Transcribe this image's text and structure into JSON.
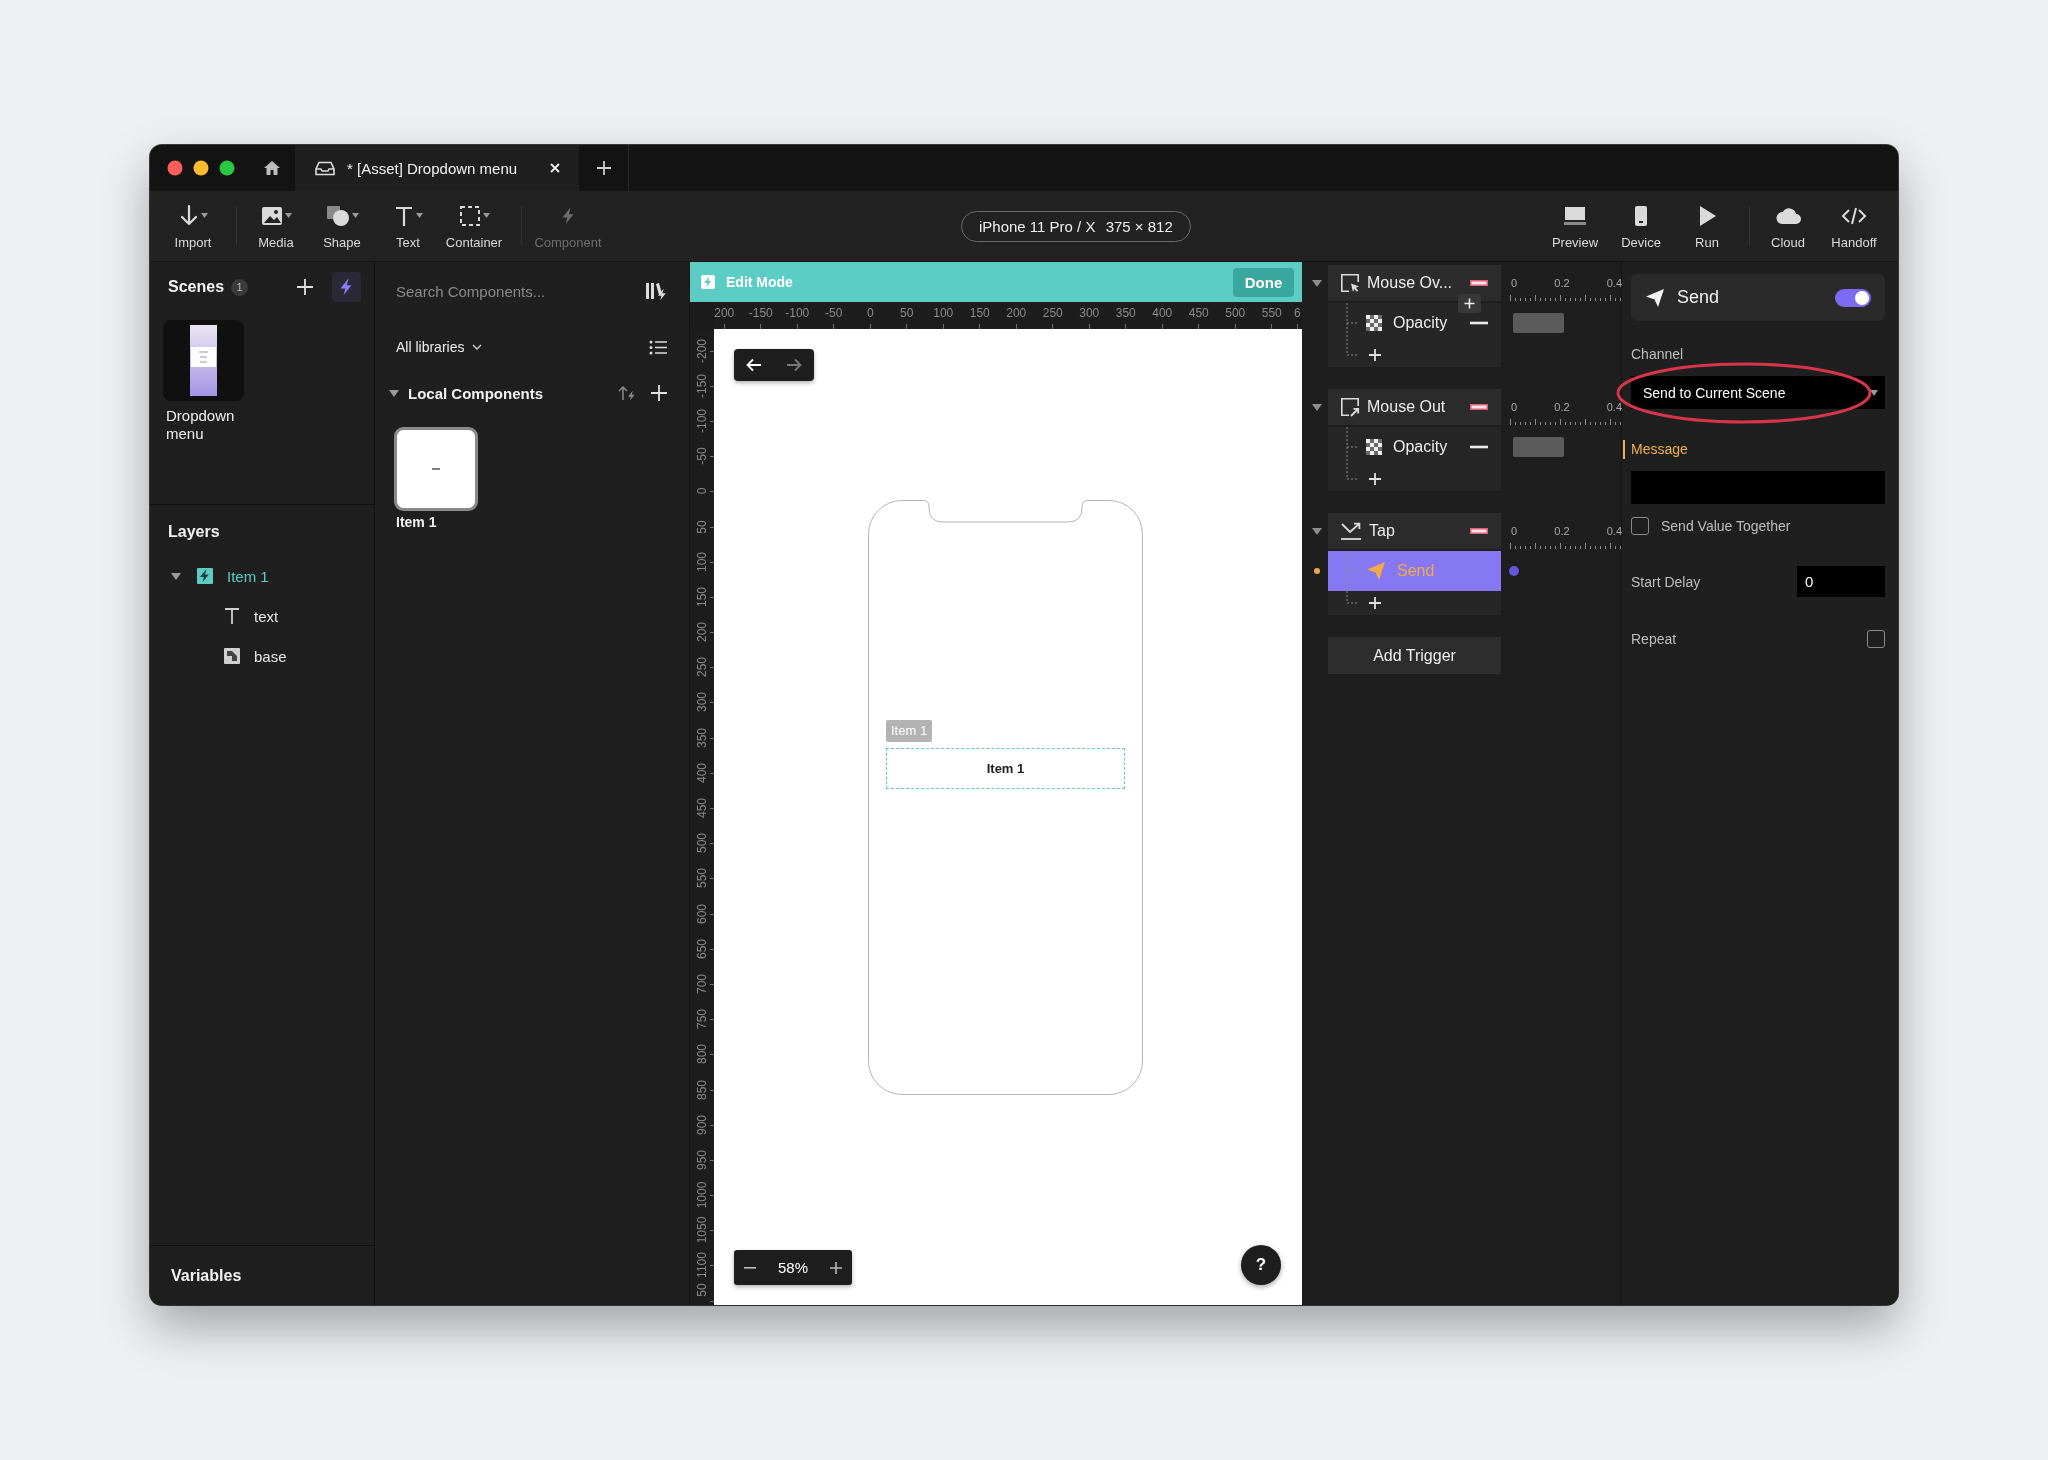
{
  "title_bar": {
    "tabs": [
      {
        "label": "* [Asset] Dropdown menu",
        "selected": true
      }
    ]
  },
  "toolbar": {
    "tool_groups": [
      [
        {
          "label": "Import",
          "kind": "import",
          "menu": true,
          "disabled": false
        }
      ],
      [
        {
          "label": "Media",
          "kind": "media",
          "menu": true,
          "disabled": false
        },
        {
          "label": "Shape",
          "kind": "shape",
          "menu": true,
          "disabled": false
        },
        {
          "label": "Text",
          "kind": "text",
          "menu": true,
          "disabled": false
        },
        {
          "label": "Container",
          "kind": "container",
          "menu": true,
          "disabled": false
        }
      ],
      [
        {
          "label": "Component",
          "kind": "component",
          "menu": false,
          "disabled": true
        }
      ]
    ],
    "device": {
      "name": "iPhone 11 Pro / X",
      "size": "375 × 812"
    },
    "action_groups": [
      [
        {
          "label": "Preview",
          "kind": "preview"
        },
        {
          "label": "Device",
          "kind": "device"
        },
        {
          "label": "Run",
          "kind": "run"
        }
      ],
      [
        {
          "label": "Cloud",
          "kind": "cloud"
        },
        {
          "label": "Handoff",
          "kind": "handoff"
        }
      ]
    ]
  },
  "scenes": {
    "title": "Scenes",
    "count": "1",
    "items": [
      {
        "name": "Dropdown menu"
      }
    ]
  },
  "layers": {
    "title": "Layers",
    "items": [
      {
        "name": "Item 1",
        "kind": "component",
        "expanded": true,
        "selected": true,
        "children": [
          {
            "name": "text",
            "kind": "text",
            "selected": false
          },
          {
            "name": "base",
            "kind": "image",
            "selected": false
          }
        ]
      }
    ]
  },
  "variables": {
    "title": "Variables"
  },
  "components": {
    "search": {
      "placeholder": "Search Components..."
    },
    "library": "All libraries",
    "sections": [
      {
        "title": "Local Components",
        "expanded": true,
        "items": [
          {
            "name": "Item 1"
          }
        ]
      }
    ]
  },
  "canvas": {
    "mode_bar": {
      "label": "Edit Mode",
      "done": "Done"
    },
    "ruler": {
      "horizontal": [
        "200",
        "-150",
        "-100",
        "-50",
        "0",
        "50",
        "100",
        "150",
        "200",
        "250",
        "300",
        "350",
        "400",
        "450",
        "500",
        "550",
        "6"
      ],
      "vertical": [
        "-200",
        "-150",
        "-100",
        "-50",
        "0",
        "50",
        "100",
        "150",
        "200",
        "250",
        "300",
        "350",
        "400",
        "450",
        "500",
        "550",
        "600",
        "650",
        "700",
        "750",
        "800",
        "850",
        "900",
        "950",
        "1000",
        "1050",
        "1100",
        "50"
      ]
    },
    "history": {
      "back_enabled": true,
      "forward_enabled": false
    },
    "elements": [
      {
        "tag": "Item 1",
        "text": "Item 1",
        "selected": true
      }
    ],
    "zoom": "58%",
    "help": "?"
  },
  "triggers": {
    "groups": [
      {
        "name": "Mouse Ov...",
        "kind": "mouse-over",
        "expanded": true,
        "add_hint": true,
        "scale": [
          "0",
          "0.2",
          "0.4"
        ],
        "actions": [
          {
            "name": "Opacity",
            "kind": "opacity",
            "selected": false
          }
        ]
      },
      {
        "name": "Mouse Out",
        "kind": "mouse-out",
        "expanded": true,
        "add_hint": false,
        "scale": [
          "0",
          "0.2",
          "0.4"
        ],
        "actions": [
          {
            "name": "Opacity",
            "kind": "opacity",
            "selected": false
          }
        ]
      },
      {
        "name": "Tap",
        "kind": "tap",
        "expanded": true,
        "add_hint": false,
        "scale": [
          "0",
          "0.2",
          "0.4"
        ],
        "actions": [
          {
            "name": "Send",
            "kind": "send",
            "selected": true
          }
        ]
      }
    ],
    "add_trigger": "Add Trigger"
  },
  "inspector": {
    "title": "Send",
    "enabled": true,
    "fields": [
      {
        "kind": "dropdown",
        "label": "Channel",
        "value": "Send to Current Scene",
        "highlighted": true
      },
      {
        "kind": "text",
        "label": "Message",
        "active": true
      },
      {
        "kind": "checkbox",
        "label": "Send Value Together",
        "checked": false
      },
      {
        "kind": "number",
        "label": "Start Delay",
        "value": "0"
      },
      {
        "kind": "option",
        "label": "Repeat",
        "checked": false
      }
    ]
  }
}
